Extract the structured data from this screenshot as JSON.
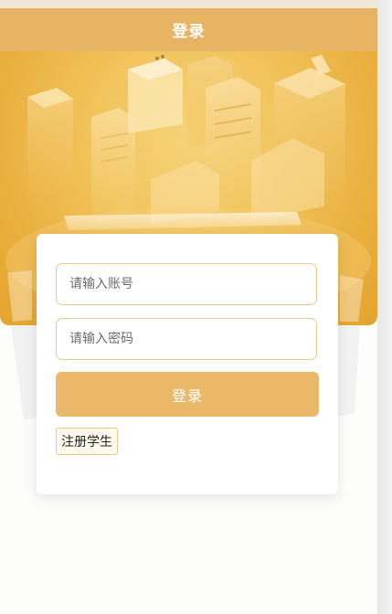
{
  "header": {
    "title": "登录"
  },
  "form": {
    "account_placeholder": "请输入账号",
    "password_placeholder": "请输入密码",
    "login_label": "登录",
    "register_label": "注册学生"
  },
  "colors": {
    "header_bg": "#e7b463",
    "hero_bg": "#e9ae3c",
    "button_bg": "#e9b868",
    "field_border": "#e8c98d",
    "page_bg": "#fdfdfc"
  }
}
